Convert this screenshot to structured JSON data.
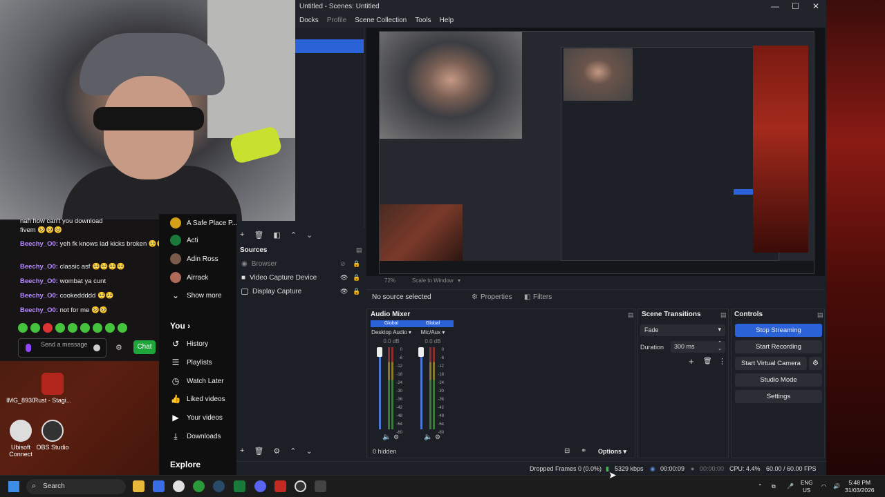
{
  "desktop": {
    "icons": [
      {
        "label": "IMG_8930"
      },
      {
        "label": "Rust - Stagi..."
      },
      {
        "label": "Ubisoft Connect"
      },
      {
        "label": "OBS Studio"
      }
    ]
  },
  "chat": {
    "lines": [
      {
        "user": "",
        "text": "nah how can't you download"
      },
      {
        "user": "",
        "text": "fivem 🥺🥺🥺"
      },
      {
        "user": "Beechy_O0:",
        "text": "yeh fk knows lad kicks broken 🥺🥺"
      },
      {
        "user": "Beechy_O0:",
        "text": "classic asf 🥺🥺🥺🥺"
      },
      {
        "user": "Beechy_O0:",
        "text": "wombat ya cunt"
      },
      {
        "user": "Beechy_O0:",
        "text": "cookeddddd 🥺🥺"
      },
      {
        "user": "Beechy_O0:",
        "text": "not for me 🥺🥺"
      }
    ],
    "input_placeholder": "Send a message",
    "chat_button": "Chat"
  },
  "youtube": {
    "subs": [
      {
        "label": "A Safe Place P..."
      },
      {
        "label": "Acti"
      },
      {
        "label": "Adin Ross"
      },
      {
        "label": "Airrack"
      }
    ],
    "show_more": "Show more",
    "you_heading": "You",
    "you_items": [
      {
        "label": "History",
        "icon": "history-icon"
      },
      {
        "label": "Playlists",
        "icon": "playlists-icon"
      },
      {
        "label": "Watch Later",
        "icon": "clock-icon"
      },
      {
        "label": "Liked videos",
        "icon": "thumbs-up-icon"
      },
      {
        "label": "Your videos",
        "icon": "play-icon"
      },
      {
        "label": "Downloads",
        "icon": "download-icon"
      }
    ],
    "explore": "Explore"
  },
  "obs": {
    "title": "Untitled - Scenes: Untitled",
    "menu": [
      "Docks",
      "Profile",
      "Scene Collection",
      "Tools",
      "Help"
    ],
    "preview_zoom": "72%",
    "preview_scale": "Scale to Window",
    "no_source": "No source selected",
    "properties_tab": "Properties",
    "filters_tab": "Filters",
    "sources": {
      "title": "Sources",
      "items": [
        {
          "label": "Browser"
        },
        {
          "label": "Video Capture Device"
        },
        {
          "label": "Display Capture"
        }
      ]
    },
    "mixer": {
      "title": "Audio Mixer",
      "channels": [
        {
          "global": "Global",
          "name": "Desktop Audio",
          "db": "0.0 dB"
        },
        {
          "global": "Global",
          "name": "Mic/Aux",
          "db": "0.0 dB"
        }
      ],
      "scale": [
        "0",
        "-6",
        "-12",
        "-18",
        "-24",
        "-30",
        "-36",
        "-42",
        "-48",
        "-54",
        "-60"
      ],
      "hidden": "0 hidden",
      "options": "Options"
    },
    "transitions": {
      "title": "Scene Transitions",
      "selected": "Fade",
      "duration_label": "Duration",
      "duration_value": "300 ms"
    },
    "controls": {
      "title": "Controls",
      "buttons": [
        "Stop Streaming",
        "Start Recording",
        "Start Virtual Camera",
        "Studio Mode",
        "Settings"
      ]
    },
    "status": {
      "dropped": "Dropped Frames 0 (0.0%)",
      "kbps": "5329 kbps",
      "stream_time": "00:00:09",
      "rec_time": "00:00:00",
      "cpu": "CPU: 4.4%",
      "fps": "60.00 / 60.00 FPS"
    }
  },
  "taskbar": {
    "search": "Search",
    "lang_top": "ENG",
    "lang_bottom": "US",
    "time": "5:48 PM",
    "date": "31/03/2026"
  },
  "colors": {
    "accent": "#2c62d8",
    "twitch_purple": "#9147ff",
    "chat_green": "#1fa63a"
  }
}
